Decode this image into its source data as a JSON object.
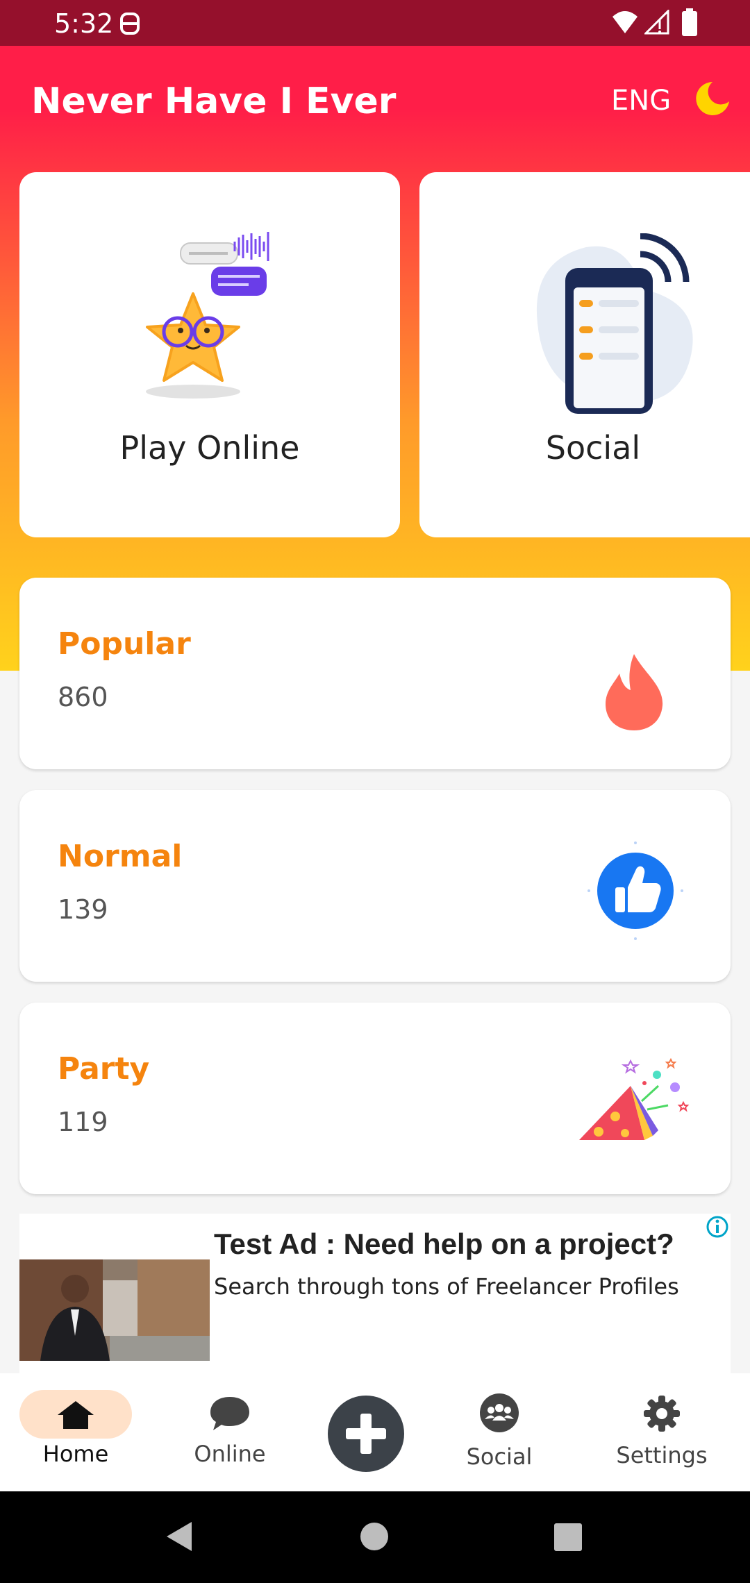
{
  "status_bar": {
    "time": "5:32"
  },
  "header": {
    "title": "Never Have I Ever",
    "language": "ENG",
    "theme_icon": "moon-icon"
  },
  "feature_cards": {
    "play_online": "Play Online",
    "social": "Social"
  },
  "categories": [
    {
      "title": "Popular",
      "count": "860",
      "icon": "fire-icon"
    },
    {
      "title": "Normal",
      "count": "139",
      "icon": "thumbs-up-icon"
    },
    {
      "title": "Party",
      "count": "119",
      "icon": "party-popper-icon"
    }
  ],
  "ad": {
    "headline": "Test Ad : Need help on a project?",
    "body": "Search through tons of Freelancer Profiles"
  },
  "bottom_nav": {
    "home": "Home",
    "online": "Online",
    "social": "Social",
    "settings": "Settings"
  },
  "colors": {
    "status_bar": "#95102C",
    "header": "#FF1E48",
    "accent_orange": "#F5840E",
    "nav_active_bg": "#FFE1C9",
    "fab": "#3C4249"
  }
}
